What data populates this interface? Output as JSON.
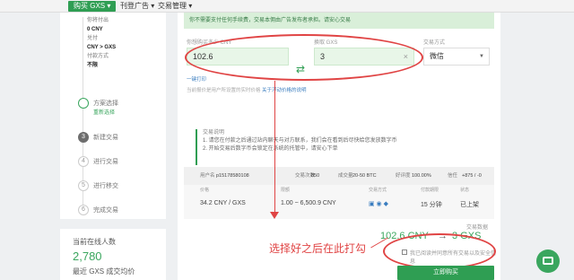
{
  "topbar": {
    "buy_label": "购买 GXS ▾",
    "menu_ads": "刊登广告 ▾",
    "menu_trades": "交易管理 ▾"
  },
  "left": {
    "summary": [
      {
        "label": "你将付出",
        "value": "0 CNY"
      },
      {
        "label": "兑付",
        "value": "CNY > GXS"
      },
      {
        "label": "付款方式",
        "value": "不限"
      }
    ],
    "steps": [
      {
        "num": "",
        "label": "方案选择",
        "sub": "重新选择"
      },
      {
        "num": "3",
        "label": "新建交易",
        "sub": ""
      },
      {
        "num": "4",
        "label": "进行交易",
        "sub": ""
      },
      {
        "num": "5",
        "label": "进行移交",
        "sub": ""
      },
      {
        "num": "6",
        "label": "完成交易",
        "sub": ""
      }
    ]
  },
  "stats": {
    "online_label": "当前在线人数",
    "online_count": "2,780",
    "avg_label": "最近 GXS 成交均价"
  },
  "main": {
    "notice": "你不需要支付任何手续费，交易本佣由广告发布者承担。请安心交易",
    "pay_label": "你想购买多少 CNY",
    "pay_value": "102.6",
    "get_label": "换取 GXS",
    "get_value": "3",
    "method_label": "交易方式",
    "method_value": "微信",
    "price_link": "一键打印",
    "price_note": "当前报价是用户所设置的实时价格",
    "price_note_link": "关于浮动价格的说明",
    "help_title": "交易说明",
    "help_lines": [
      "1. 请您在付款之后通过站内聊天与对方联系，我们会在看到后尽快给您发放数字币",
      "2. 开始交易后数字币会锁定在系统的托管中，请安心下单"
    ],
    "table": {
      "user_label": "用户名",
      "user_value": "p15178580108",
      "trade_count_label": "交易次数",
      "trade_count_value": "850",
      "volume_label": "成交量",
      "volume_value": "20-50 BTC",
      "rate_label": "好评度",
      "rate_value": "100.00%",
      "trust_label": "信任",
      "trust_value": "+875 / -0",
      "col_price": "价格",
      "col_limit": "限额",
      "col_method": "交易方式",
      "col_time": "付款期限",
      "col_status": "状态",
      "price": "34.2 CNY / GXS",
      "limit": "1.00 ~ 6,500.9 CNY",
      "time": "15 分钟",
      "status": "已上架"
    },
    "total_label": "交易数据",
    "total_cny": "102.6 CNY",
    "total_gxs": "3 GXS",
    "agree_label": "我已阅读并同意所有交易以及安全信息",
    "confirm_button": "立即购买"
  },
  "annotation": "选择好之后在此打勾"
}
